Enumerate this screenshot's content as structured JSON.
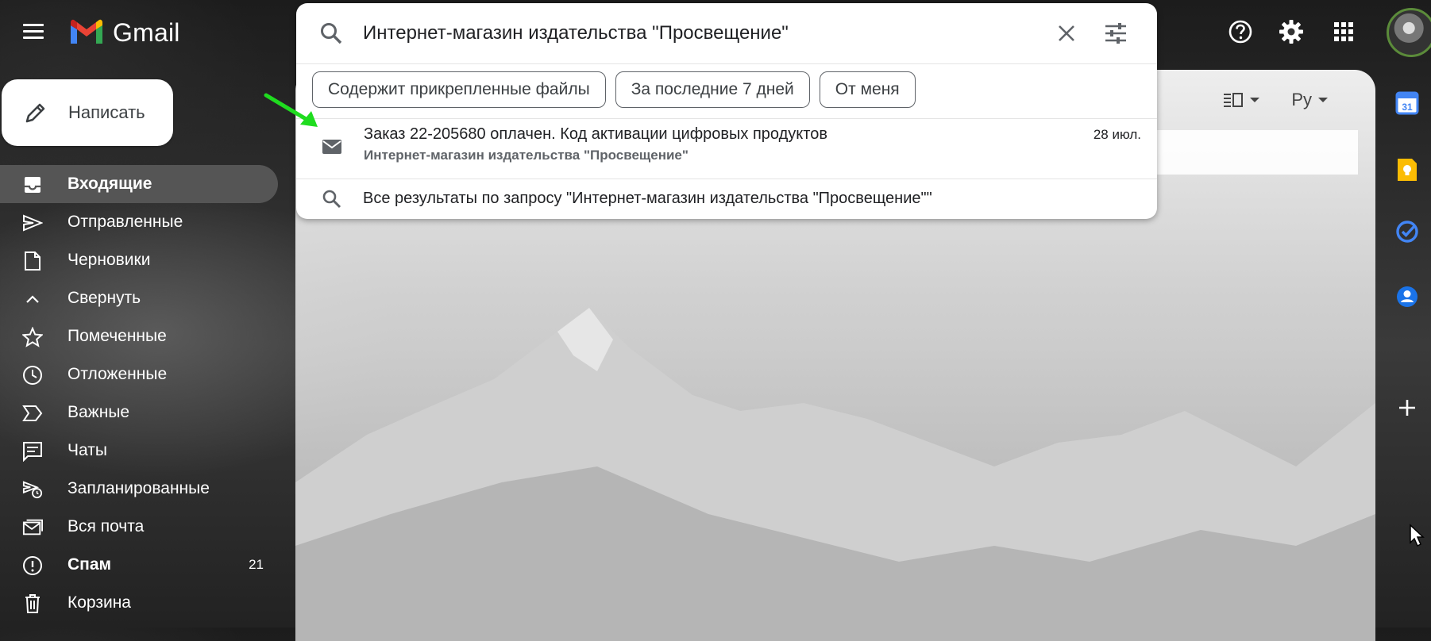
{
  "app": {
    "name": "Gmail"
  },
  "compose": {
    "label": "Написать"
  },
  "sidebar": {
    "items": [
      {
        "label": "Входящие",
        "active": true,
        "bold": true,
        "icon": "inbox-icon"
      },
      {
        "label": "Отправленные",
        "icon": "send-icon"
      },
      {
        "label": "Черновики",
        "icon": "draft-icon"
      },
      {
        "label": "Свернуть",
        "icon": "chevron-up-icon"
      },
      {
        "label": "Помеченные",
        "icon": "star-icon"
      },
      {
        "label": "Отложенные",
        "icon": "clock-icon"
      },
      {
        "label": "Важные",
        "icon": "important-icon"
      },
      {
        "label": "Чаты",
        "icon": "chat-icon"
      },
      {
        "label": "Запланированные",
        "icon": "scheduled-send-icon"
      },
      {
        "label": "Вся почта",
        "icon": "all-mail-icon"
      },
      {
        "label": "Спам",
        "bold": true,
        "count": "21",
        "icon": "spam-icon"
      },
      {
        "label": "Корзина",
        "icon": "trash-icon"
      }
    ]
  },
  "search": {
    "query": "Интернет-магазин издательства \"Просвещение\"",
    "chips": [
      "Содержит прикрепленные файлы",
      "За последние 7 дней",
      "От меня"
    ],
    "suggestion": {
      "subject": "Заказ 22-205680 оплачен. Код активации цифровых продуктов",
      "sender": "Интернет-магазин издательства \"Просвещение\"",
      "date": "28 июл."
    },
    "all_results": "Все результаты по запросу \"Интернет-магазин издательства \"Просвещение\"\""
  },
  "toolbar": {
    "language": "Ру"
  },
  "colors": {
    "accent_green": "#1fdc1f",
    "active_item_bg": "#555555",
    "gmail_red": "#EA4335",
    "gmail_blue": "#4285F4",
    "gmail_yellow": "#FBBC04",
    "gmail_green": "#34A853"
  }
}
